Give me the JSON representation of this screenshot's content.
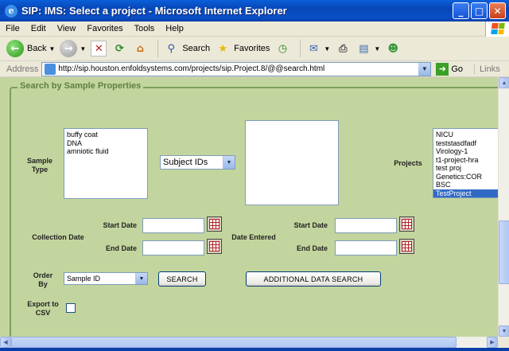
{
  "window": {
    "title": "SIP: IMS: Select a project - Microsoft Internet Explorer"
  },
  "menu": [
    "File",
    "Edit",
    "View",
    "Favorites",
    "Tools",
    "Help"
  ],
  "toolbar": {
    "back_label": "Back",
    "search_label": "Search",
    "favorites_label": "Favorites"
  },
  "address": {
    "label": "Address",
    "url": "http://sip.houston.enfoldsystems.com/projects/sip.Project.8/@@search.html",
    "go_label": "Go",
    "links_label": "Links"
  },
  "form": {
    "legend": "Search by Sample Properties",
    "sample_type_label": "Sample Type",
    "sample_types": [
      "buffy coat",
      "DNA",
      "amniotic fluid"
    ],
    "subject_select": "Subject IDs",
    "projects_label": "Projects",
    "projects": [
      "NICU",
      "teststasdfadf",
      "Virology-1",
      "t1-project-hra",
      "test proj",
      "Genetics:COR",
      "BSC",
      "TestProject"
    ],
    "collection_date_label": "Collection Date",
    "date_entered_label": "Date Entered",
    "start_date_label": "Start Date",
    "end_date_label": "End Date",
    "order_by_label": "Order By",
    "order_by_value": "Sample ID",
    "search_button": "SEARCH",
    "additional_button": "ADDITIONAL DATA SEARCH",
    "export_label": "Export to CSV"
  }
}
